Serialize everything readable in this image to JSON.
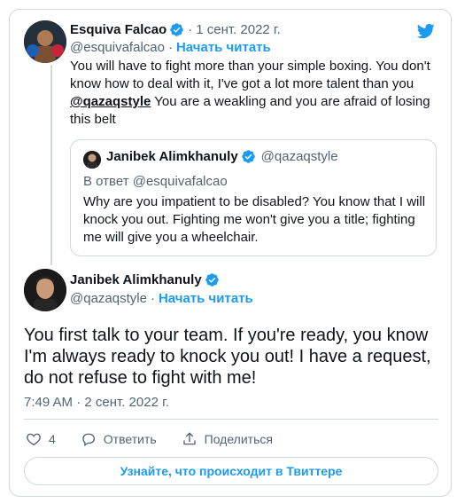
{
  "tweet_parent": {
    "author_name": "Esquiva Falcao",
    "handle": "@esquivafalcao",
    "date": "1 сент. 2022 г.",
    "follow_label": "Начать читать",
    "text_part1": "You will have to fight more than your simple boxing. You don't know how to deal with it, I've got a lot more talent than you ",
    "mention": "@qazaqstyle",
    "text_part2": "  You are a weakling and you are afraid of losing this belt"
  },
  "quoted": {
    "author_name": "Janibek Alimkhanuly",
    "handle": "@qazaqstyle",
    "reply_to": "В ответ @esquivafalcao",
    "text": "Why are you impatient to be disabled? You know that I will knock you out. Fighting me won't give you a title; fighting me will give you a wheelchair."
  },
  "tweet_main": {
    "author_name": "Janibek Alimkhanuly",
    "handle": "@qazaqstyle",
    "follow_label": "Начать читать",
    "text": "You first talk to your team. If you're ready, you know I'm always ready to knock you out! I have a request, do not refuse to fight with me!",
    "timestamp": "7:49 AM · 2 сент. 2022 г."
  },
  "actions": {
    "like_count": "4",
    "reply_label": "Ответить",
    "share_label": "Поделиться"
  },
  "cta_label": "Узнайте, что происходит в Твиттере",
  "colors": {
    "accent": "#1d9bf0",
    "text": "#0f1419",
    "muted": "#536471",
    "border": "#cfd9de"
  },
  "icons": [
    "twitter-bird-icon",
    "verified-badge-icon",
    "heart-icon",
    "reply-icon",
    "share-icon"
  ]
}
